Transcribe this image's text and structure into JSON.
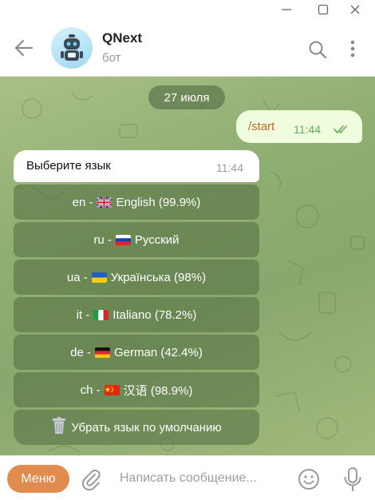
{
  "chat": {
    "title": "QNext",
    "subtitle": "бот",
    "date_label": "27 июля"
  },
  "messages": {
    "outgoing": {
      "text": "/start",
      "time": "11:44"
    },
    "incoming": {
      "text": "Выберите язык",
      "time": "11:44"
    }
  },
  "keyboard": {
    "buttons": [
      {
        "label": "en - ",
        "flag": "uk",
        "name": "English (99.9%)"
      },
      {
        "label": "ru - ",
        "flag": "ru",
        "name": "Русский"
      },
      {
        "label": "ua - ",
        "flag": "ua",
        "name": "Українська (98%)"
      },
      {
        "label": "it - ",
        "flag": "it",
        "name": "Italiano (78.2%)"
      },
      {
        "label": "de - ",
        "flag": "de",
        "name": "German (42.4%)"
      },
      {
        "label": "ch - ",
        "flag": "cn",
        "name": "汉语 (98.9%)"
      },
      {
        "label": "",
        "icon": "wastebasket-icon",
        "name": "Убрать язык по умолчанию"
      }
    ]
  },
  "composer": {
    "menu_label": "Меню",
    "placeholder": "Написать сообщение..."
  },
  "colors": {
    "accent": "#e18b4e",
    "outgoing_bubble": "#effdde",
    "outgoing_text": "#c0661f",
    "read_checks": "#5fae5d",
    "chat_background": "#8fae72"
  }
}
